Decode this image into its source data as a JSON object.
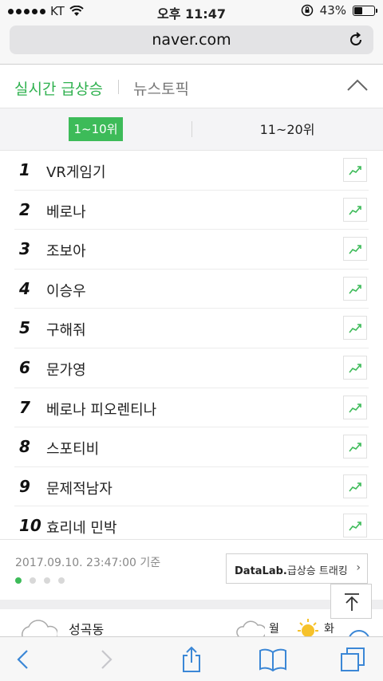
{
  "status_bar": {
    "carrier": "KT",
    "time": "오후 11:47",
    "battery_text": "43%",
    "battery_level": 0.43
  },
  "browser": {
    "url": "naver.com"
  },
  "tabs": {
    "active": "실시간 급상승",
    "other": "뉴스토픽"
  },
  "range_toggle": {
    "active": "1~10위",
    "other": "11~20위"
  },
  "ranking": [
    {
      "rank": "1",
      "keyword": "VR게임기"
    },
    {
      "rank": "2",
      "keyword": "베로나"
    },
    {
      "rank": "3",
      "keyword": "조보아"
    },
    {
      "rank": "4",
      "keyword": "이승우"
    },
    {
      "rank": "5",
      "keyword": "구해줘"
    },
    {
      "rank": "6",
      "keyword": "문가영"
    },
    {
      "rank": "7",
      "keyword": "베로나 피오렌티나"
    },
    {
      "rank": "8",
      "keyword": "스포티비"
    },
    {
      "rank": "9",
      "keyword": "문제적남자"
    },
    {
      "rank": "10",
      "keyword": "효리네 민박"
    }
  ],
  "footer": {
    "timestamp": "2017.09.10. 23:47:00 기준",
    "datalab_brand": "DataLab.",
    "datalab_text": "급상승 트래킹",
    "pager_total": 4,
    "pager_active": 1
  },
  "weather": {
    "place": "성곡동",
    "day1": "월",
    "day2": "화"
  },
  "colors": {
    "accent_green": "#2fb14f",
    "active_bg": "#3dbb59",
    "ios_blue": "#3b87d6"
  },
  "icons": {
    "trend": "trend-chart-icon",
    "reload": "reload-icon",
    "collapse": "chevron-up-icon",
    "scroll_top": "arrow-up-to-top-icon",
    "back": "chevron-left-icon",
    "forward": "chevron-right-icon",
    "share": "share-icon",
    "bookmarks": "book-icon",
    "tabs": "tabs-icon"
  }
}
